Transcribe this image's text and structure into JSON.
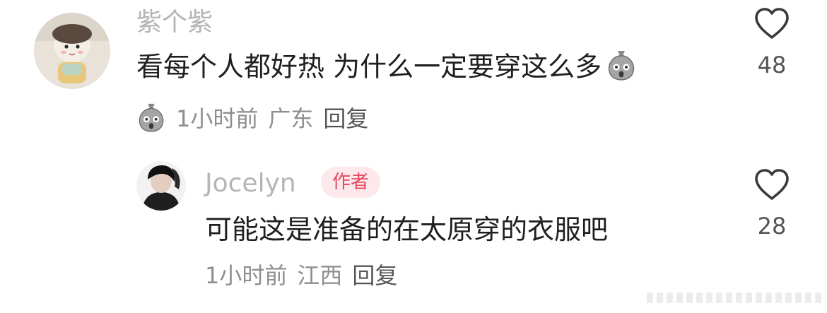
{
  "comments": [
    {
      "username": "紫个紫",
      "content": "看每个人都好热 为什么一定要穿这么多",
      "content_emoji": "sack-face-emoji",
      "meta_emoji": "sack-face-emoji",
      "time": "1小时前",
      "location": "广东",
      "reply_label": "回复",
      "like_count": "48"
    }
  ],
  "replies": [
    {
      "username": "Jocelyn",
      "badge": "作者",
      "content": "可能这是准备的在太原穿的衣服吧",
      "time": "1小时前",
      "location": "江西",
      "reply_label": "回复",
      "like_count": "28"
    }
  ],
  "colors": {
    "username": "#b5b5b5",
    "badge_bg": "#fde8ec",
    "badge_text": "#e5485f",
    "meta": "#8e8e8e"
  },
  "icons": {
    "like": "heart-outline-icon"
  }
}
